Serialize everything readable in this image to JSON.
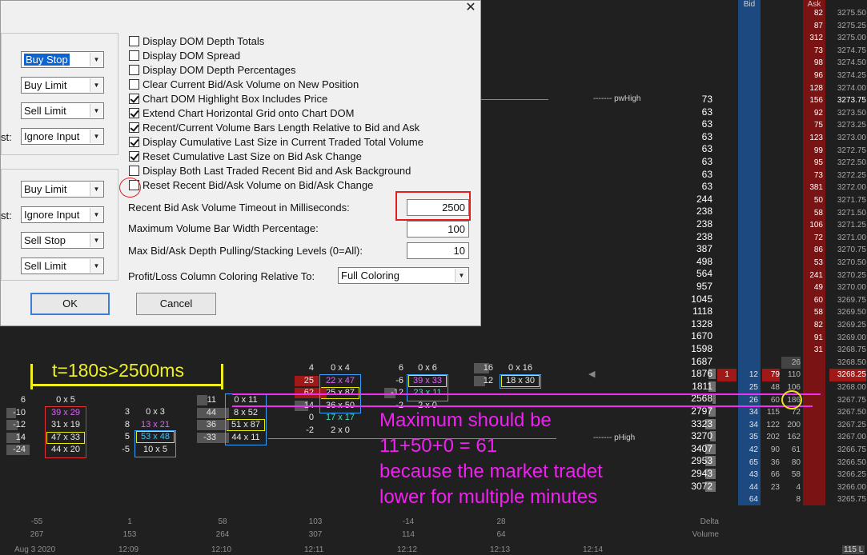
{
  "dialog": {
    "close_label": "✕",
    "left_combos": [
      {
        "value": "Buy Stop",
        "selected": true
      },
      {
        "value": "Buy Limit"
      },
      {
        "value": "Sell Limit"
      },
      {
        "value": "Ignore Input"
      },
      {
        "value": "Buy Limit"
      },
      {
        "value": "Ignore Input"
      },
      {
        "value": "Sell Stop"
      },
      {
        "value": "Sell Limit"
      }
    ],
    "left_label_fragments": [
      "st:",
      "st:"
    ],
    "checkboxes": [
      {
        "label": "Display DOM Depth Totals",
        "checked": false
      },
      {
        "label": "Display DOM Spread",
        "checked": false
      },
      {
        "label": "Display DOM Depth Percentages",
        "checked": false
      },
      {
        "label": "Clear Current Bid/Ask Volume on New Position",
        "checked": false
      },
      {
        "label": "Chart DOM Highlight Box Includes Price",
        "checked": true
      },
      {
        "label": "Extend Chart Horizontal Grid onto Chart DOM",
        "checked": true
      },
      {
        "label": "Recent/Current Volume Bars Length Relative to Bid and Ask",
        "checked": true
      },
      {
        "label": "Display Cumulative Last Size in Current Traded Total Volume",
        "checked": true
      },
      {
        "label": "Reset Cumulative Last Size on Bid Ask Change",
        "checked": true
      },
      {
        "label": "Display Both Last Traded Recent Bid and Ask Background",
        "checked": false
      },
      {
        "label": "Reset Recent Bid/Ask Volume on Bid/Ask Change",
        "checked": false
      }
    ],
    "fields": [
      {
        "label": "Recent Bid Ask Volume Timeout in Milliseconds:",
        "value": "2500"
      },
      {
        "label": "Maximum Volume Bar Width Percentage:",
        "value": "100"
      },
      {
        "label": "Max Bid/Ask Depth Pulling/Stacking Levels (0=All):",
        "value": "10"
      }
    ],
    "coloring": {
      "label": "Profit/Loss Column Coloring Relative To:",
      "value": "Full Coloring"
    },
    "ok_label": "OK",
    "cancel_label": "Cancel"
  },
  "chart": {
    "pwhigh_label": "------- pwHigh",
    "phigh_label": "------- pHigh",
    "col_bid_label": "Bid",
    "col_ask_label": "Ask",
    "volume_profile": [
      {
        "v": "73",
        "w": 0
      },
      {
        "v": "63",
        "w": 0
      },
      {
        "v": "63",
        "w": 0
      },
      {
        "v": "63",
        "w": 0
      },
      {
        "v": "63",
        "w": 0
      },
      {
        "v": "63",
        "w": 0
      },
      {
        "v": "63",
        "w": 0
      },
      {
        "v": "63",
        "w": 0
      },
      {
        "v": "244",
        "w": 0
      },
      {
        "v": "238",
        "w": 0
      },
      {
        "v": "238",
        "w": 0
      },
      {
        "v": "238",
        "w": 0
      },
      {
        "v": "387",
        "w": 0
      },
      {
        "v": "498",
        "w": 0
      },
      {
        "v": "564",
        "w": 0
      },
      {
        "v": "957",
        "w": 0
      },
      {
        "v": "1045",
        "w": 0
      },
      {
        "v": "1118",
        "w": 0
      },
      {
        "v": "1328",
        "w": 0
      },
      {
        "v": "1670",
        "w": 0
      },
      {
        "v": "1598",
        "w": 0
      },
      {
        "v": "1687",
        "w": 0
      },
      {
        "v": "1876",
        "w": 0.2
      },
      {
        "v": "1811",
        "w": 0.2
      },
      {
        "v": "2568",
        "w": 0.1
      },
      {
        "v": "2797",
        "w": 0.2
      },
      {
        "v": "3323",
        "w": 0.3
      },
      {
        "v": "3270",
        "w": 0.15
      },
      {
        "v": "3407",
        "w": 0.3
      },
      {
        "v": "2953",
        "w": 0.3
      },
      {
        "v": "2943",
        "w": 0.3
      },
      {
        "v": "3072",
        "w": 0.3
      }
    ],
    "prices": [
      "3275.50",
      "3275.25",
      "3275.00",
      "3274.75",
      "3274.50",
      "3274.25",
      "3274.00",
      "3273.75",
      "3273.50",
      "3273.25",
      "3273.00",
      "3272.75",
      "3272.50",
      "3272.25",
      "3272.00",
      "3271.75",
      "3271.50",
      "3271.25",
      "3271.00",
      "3270.75",
      "3270.50",
      "3270.25",
      "3270.00",
      "3269.75",
      "3269.50",
      "3269.25",
      "3269.00",
      "3268.75",
      "3268.50",
      "3268.25",
      "3268.00",
      "3267.75",
      "3267.50",
      "3267.25",
      "3267.00",
      "3266.75",
      "3266.50",
      "3266.25",
      "3266.00",
      "3265.75"
    ],
    "current_price_index": 29,
    "ask_sizes": [
      "82",
      "87",
      "312",
      "73",
      "98",
      "96",
      "128",
      "156",
      "92",
      "75",
      "123",
      "99",
      "95",
      "73",
      "381",
      "50",
      "58",
      "106",
      "72",
      "86",
      "53",
      "241",
      "49",
      "60",
      "58",
      "82",
      "91",
      "31"
    ],
    "bid_rows": [
      {
        "bid": "12",
        "bidrec": "79",
        "askrec": "110",
        "marker": "1"
      },
      {
        "bid": "25",
        "bidrec": "48",
        "askrec": "106"
      },
      {
        "bid": "26",
        "bidrec": "60",
        "askrec": "186"
      },
      {
        "bid": "34",
        "bidrec": "115",
        "askrec": "72"
      },
      {
        "bid": "34",
        "bidrec": "122",
        "askrec": "200"
      },
      {
        "bid": "35",
        "bidrec": "202",
        "askrec": "162"
      },
      {
        "bid": "42",
        "bidrec": "90",
        "askrec": "61"
      },
      {
        "bid": "65",
        "bidrec": "36",
        "askrec": "80"
      },
      {
        "bid": "43",
        "bidrec": "66",
        "askrec": "58"
      },
      {
        "bid": "44",
        "bidrec": "23",
        "askrec": "4"
      },
      {
        "bid": "64",
        "bidrec": "",
        "askrec": "8"
      }
    ],
    "extra_askrec_top": "26",
    "footprints": [
      {
        "delta_label": "-10",
        "rows": [
          "0 x 5",
          "39 x 29",
          "31 x 19",
          "47 x 33",
          "44 x 20"
        ],
        "side": [
          "6",
          "-10",
          "-12",
          "14",
          "-24"
        ]
      },
      {
        "rows": [
          "0 x 3",
          "13 x 21",
          "53 x 48",
          "10 x 5"
        ],
        "side": [
          "3",
          "8",
          "5",
          "-5"
        ]
      },
      {
        "rows": [
          "0 x 11",
          "8 x 52",
          "51 x 87",
          "44 x 11"
        ],
        "side": [
          "11",
          "44",
          "36",
          "-33"
        ]
      },
      {
        "rows": [
          "0 x 4",
          "22 x 47",
          "25 x 87",
          "36 x 50",
          "17 x 17",
          "2 x 0"
        ],
        "side": [
          "4",
          "25",
          "62",
          "14",
          "0",
          "-2"
        ]
      },
      {
        "rows": [
          "0 x 6",
          "39 x 33",
          "23 x 11",
          "2 x 0"
        ],
        "side": [
          "6",
          "-6",
          "-12",
          "-2"
        ]
      },
      {
        "rows": [
          "0 x 16",
          "18 x 30"
        ],
        "side": [
          "16",
          "12"
        ]
      }
    ],
    "delta_row": [
      "-55",
      "1",
      "58",
      "103",
      "-14",
      "28"
    ],
    "volume_row": [
      "267",
      "153",
      "264",
      "307",
      "114",
      "64"
    ],
    "delta_label": "Delta",
    "volume_label": "Volume",
    "times": [
      "Aug 3 2020",
      "12:09",
      "12:10",
      "12:11",
      "12:12",
      "12:13",
      "12:14"
    ],
    "corner_label": "115 L",
    "annotation_yellow": "t=180s>2500ms",
    "annotation_magenta": [
      "Maximum should be",
      "11+50+0 = 61",
      "because the market tradet",
      "lower for multiple minutes"
    ]
  }
}
